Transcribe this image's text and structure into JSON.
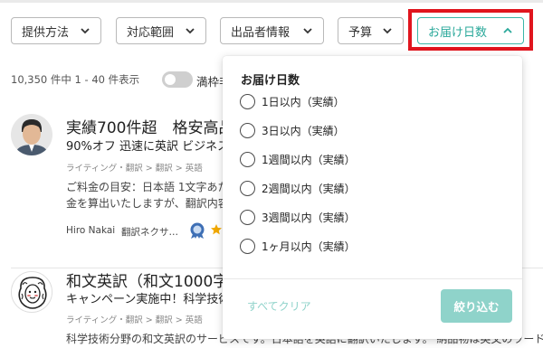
{
  "filters": [
    {
      "label": "提供方法"
    },
    {
      "label": "対応範囲"
    },
    {
      "label": "出品者情報"
    },
    {
      "label": "予算"
    },
    {
      "label": "お届け日数"
    }
  ],
  "results": {
    "count_text": "10,350 件中 1 - 40 件表示",
    "toggle_label": "満枠非"
  },
  "listings": [
    {
      "title": "実績700件超　格安高品",
      "subtitle": "90%オフ 迅速に英訳 ビジネス",
      "breadcrumb": "ライティング・翻訳 > 翻訳 > 英語",
      "desc_lines": [
        "ご料金の目安：日本語 1文字あた",
        "金を算出いたしますが、翻訳内容"
      ],
      "seller_name": "Hiro Nakai",
      "seller_rank": "翻訳ネクサ…"
    },
    {
      "title": "和文英訳（和文1000字",
      "subtitle": "キャンペーン実施中！科学技術",
      "breadcrumb": "ライティング・翻訳 > 翻訳 > 英語",
      "desc_lines": [
        "科学技術分野の和文英訳のサービスです。日本語を英語に翻訳いたします。 納品物は英文のワードフ"
      ]
    }
  ],
  "dropdown": {
    "title": "お届け日数",
    "options": [
      "1日以内（実績）",
      "3日以内（実績）",
      "1週間以内（実績）",
      "2週間以内（実績）",
      "3週間以内（実績）",
      "1ヶ月以内（実績）"
    ],
    "clear_label": "すべてクリア",
    "apply_label": "絞り込む"
  },
  "colors": {
    "accent": "#2aa89a",
    "accent_light": "#8fd3ca",
    "highlight": "#e0151e"
  }
}
